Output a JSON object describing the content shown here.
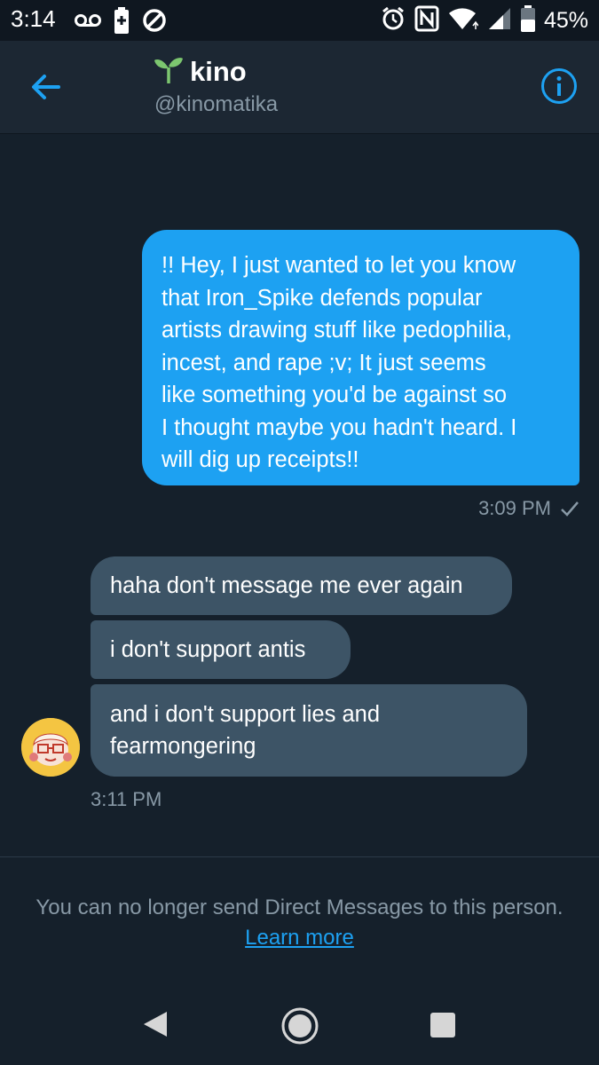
{
  "status_bar": {
    "time": "3:14",
    "battery_percent": "45%",
    "icons_left": [
      "voicemail-icon",
      "battery-saver-icon",
      "do-not-disturb-icon"
    ],
    "icons_right": [
      "alarm-icon",
      "nfc-icon",
      "wifi-icon",
      "signal-icon",
      "battery-icon"
    ]
  },
  "header": {
    "name": "kino",
    "handle": "@kinomatika",
    "accent": "#1da1f2",
    "name_emoji_icon": "seedling-icon"
  },
  "conversation": {
    "sent": {
      "lines": [
        "!! Hey, I just wanted to let you know",
        "that Iron_Spike defends popular",
        "artists drawing stuff like pedophilia,",
        "incest, and rape ;v; It just seems",
        "like something you'd be against so",
        "I thought maybe you hadn't heard. I",
        "will dig up receipts!!"
      ],
      "time": "3:09 PM"
    },
    "received": [
      {
        "lines": [
          "haha don't message me ever again"
        ]
      },
      {
        "lines": [
          "i don't support antis"
        ]
      },
      {
        "lines": [
          "and i don't support lies and",
          "fearmongering"
        ]
      }
    ],
    "received_time": "3:11 PM"
  },
  "notice": {
    "text": "You can no longer send Direct Messages to this person.",
    "link": "Learn more"
  },
  "colors": {
    "background": "#15202b",
    "header_bg": "#1c2733",
    "sent_bubble": "#1da1f2",
    "received_bubble": "#3d5466",
    "muted_text": "#8899a6"
  }
}
